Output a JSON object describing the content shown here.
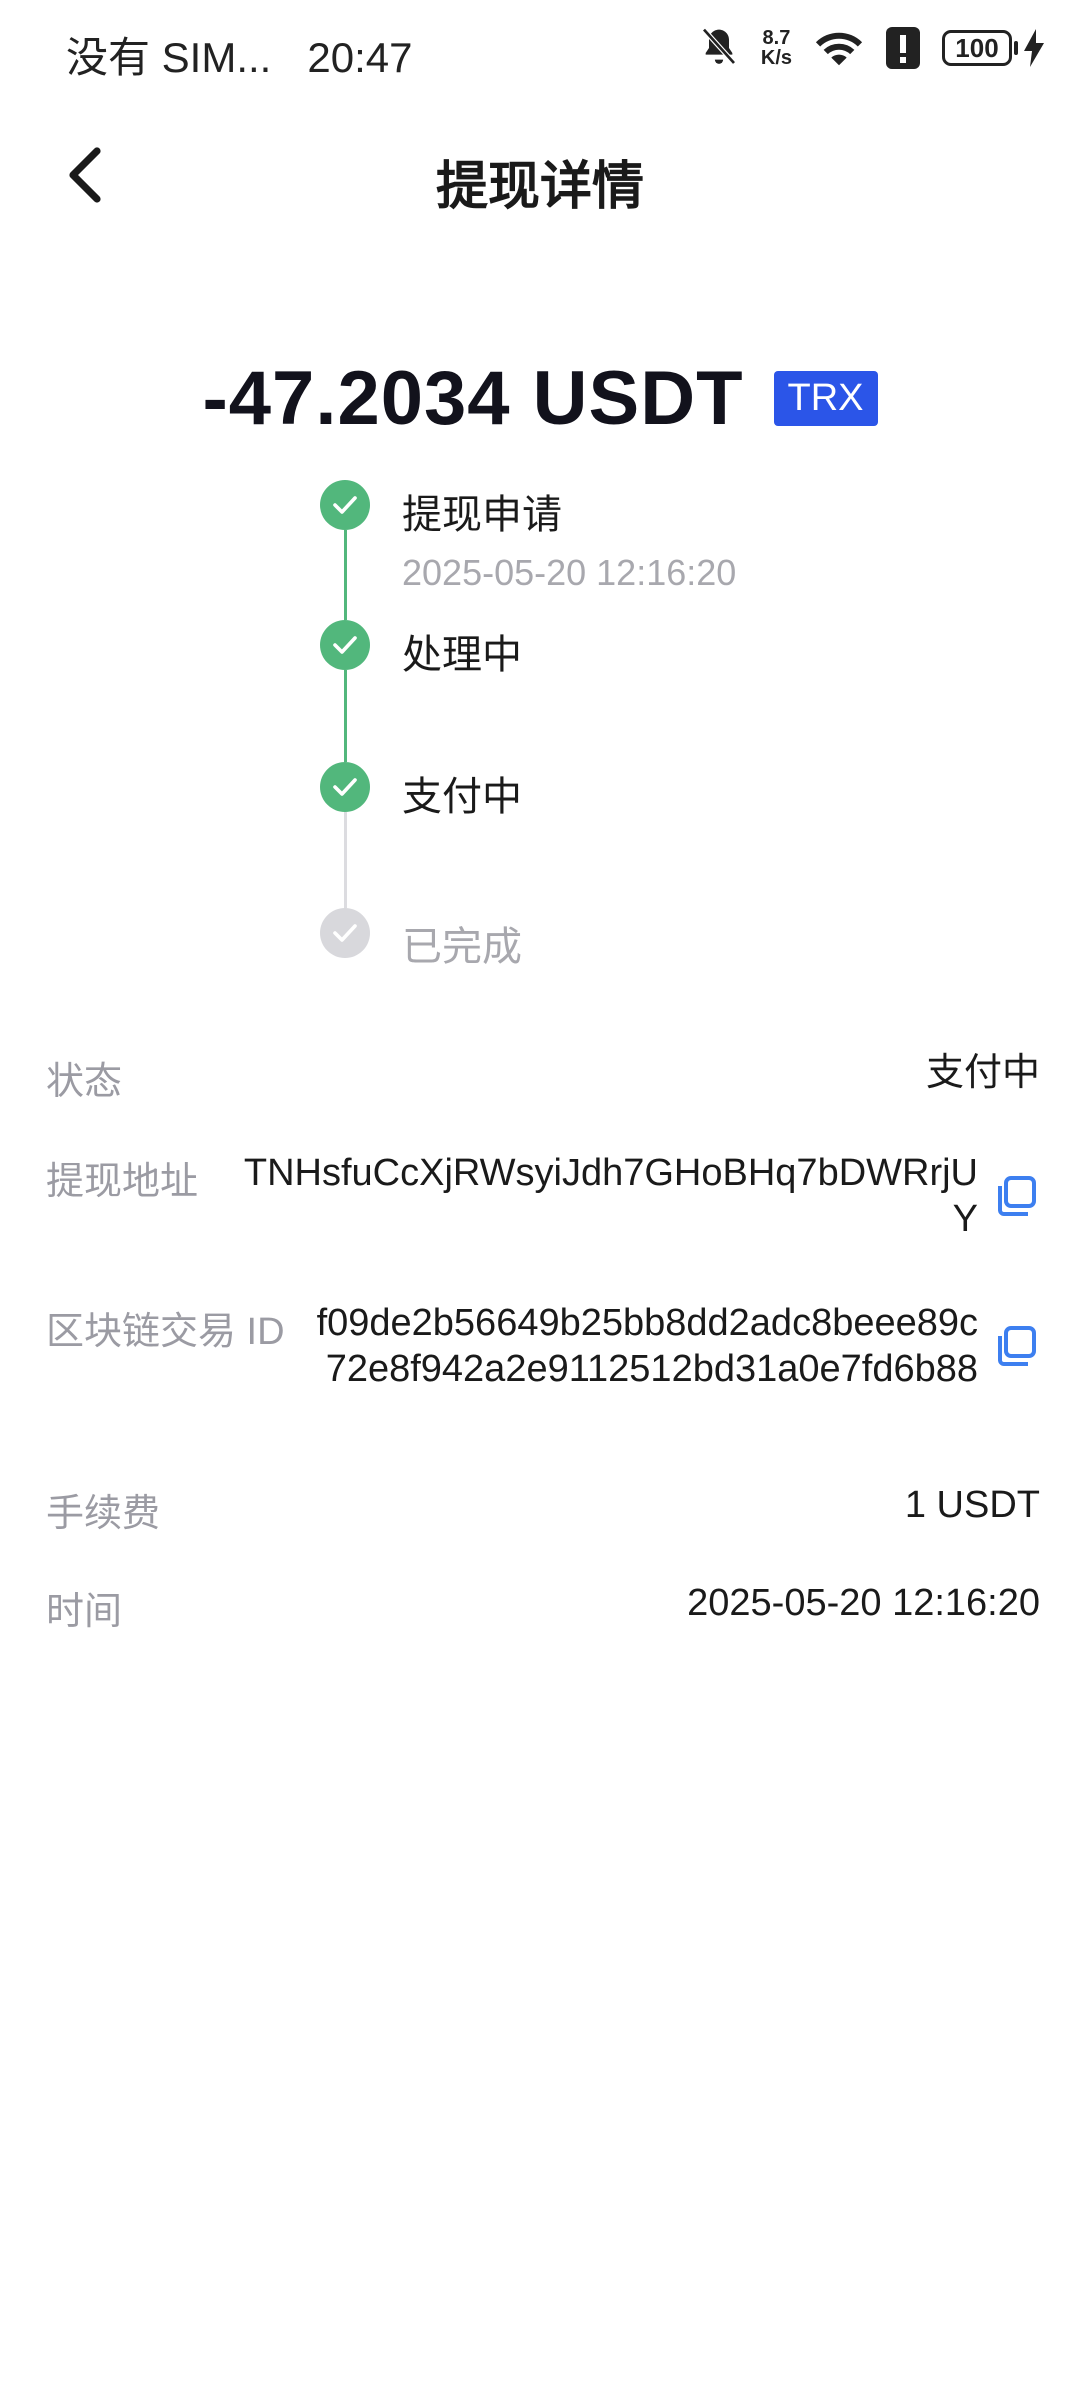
{
  "status_bar": {
    "carrier": "没有 SIM...",
    "time": "20:47",
    "speed_top": "8.7",
    "speed_bottom": "K/s",
    "battery": "100"
  },
  "header": {
    "title": "提现详情",
    "back_icon": "chevron-left-icon"
  },
  "amount": {
    "value": "-47.2034 USDT",
    "chain": "TRX"
  },
  "timeline": {
    "steps": [
      {
        "label": "提现申请",
        "time": "2025-05-20 12:16:20",
        "done": true
      },
      {
        "label": "处理中",
        "done": true
      },
      {
        "label": "支付中",
        "done": true
      },
      {
        "label": "已完成",
        "done": false
      }
    ]
  },
  "details": {
    "status_label": "状态",
    "status_value": "支付中",
    "address_label": "提现地址",
    "address_value": "TNHsfuCcXjRWsyiJdh7GHoBHq7bDWRrjUY",
    "txid_label": "区块链交易 ID",
    "txid_value": "f09de2b56649b25bb8dd2adc8beee89c72e8f942a2e9112512bd31a0e7fd6b88",
    "fee_label": "手续费",
    "fee_value": "1 USDT",
    "time_label": "时间",
    "time_value": "2025-05-20 12:16:20"
  },
  "colors": {
    "accent_green": "#52b77c",
    "badge_blue": "#2b55e8",
    "copy_blue": "#3d7ff0",
    "muted": "#9b9ba3"
  }
}
